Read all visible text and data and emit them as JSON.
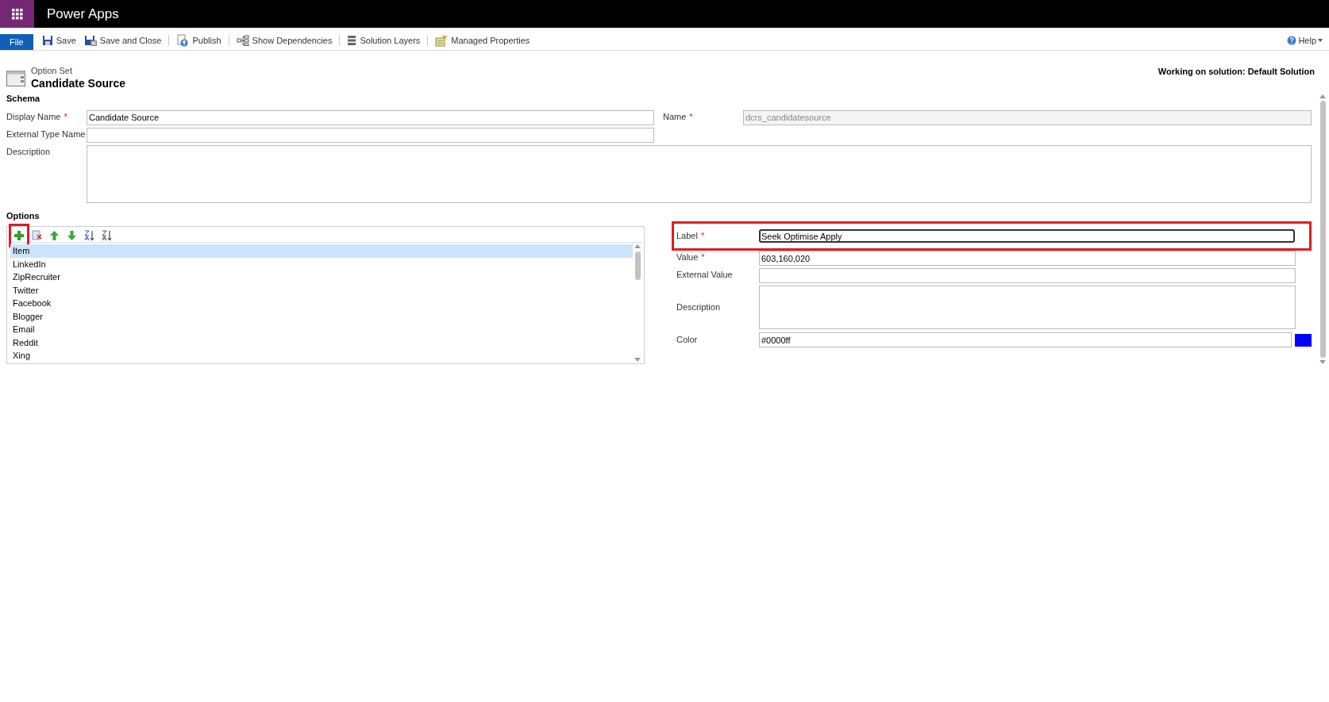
{
  "app": {
    "title": "Power Apps"
  },
  "toolbar": {
    "file": "File",
    "items": [
      {
        "kind": "save",
        "label": "Save"
      },
      {
        "kind": "save-close",
        "label": "Save and Close"
      },
      {
        "kind": "publish",
        "label": "Publish"
      },
      {
        "kind": "dependencies",
        "label": "Show Dependencies"
      },
      {
        "kind": "layers",
        "label": "Solution Layers"
      },
      {
        "kind": "managed",
        "label": "Managed Properties"
      }
    ],
    "help": "Help"
  },
  "header": {
    "type": "Option Set",
    "title": "Candidate Source",
    "solution": "Working on solution: Default Solution"
  },
  "schema": {
    "heading": "Schema",
    "display_name": {
      "label": "Display Name",
      "required_mark": "*",
      "value": "Candidate Source"
    },
    "name": {
      "label": "Name",
      "required_mark": "*",
      "value": "dcrs_candidatesource",
      "disabled": true
    },
    "external_type_name": {
      "label": "External Type Name"
    },
    "description": {
      "label": "Description"
    }
  },
  "options": {
    "heading": "Options",
    "tools": [
      {
        "kind": "add",
        "highlighted": true
      },
      {
        "kind": "delete",
        "highlighted": false
      },
      {
        "kind": "up",
        "highlighted": false
      },
      {
        "kind": "down",
        "highlighted": false
      },
      {
        "kind": "sort-az",
        "highlighted": false
      },
      {
        "kind": "sort-za",
        "highlighted": false
      }
    ],
    "items": [
      {
        "label": "Item",
        "selected": true
      },
      {
        "label": "LinkedIn",
        "selected": false
      },
      {
        "label": "ZipRecruiter",
        "selected": false
      },
      {
        "label": "Twitter",
        "selected": false
      },
      {
        "label": "Facebook",
        "selected": false
      },
      {
        "label": "Blogger",
        "selected": false
      },
      {
        "label": "Email",
        "selected": false
      },
      {
        "label": "Reddit",
        "selected": false
      },
      {
        "label": "Xing",
        "selected": false
      }
    ]
  },
  "option_form": {
    "label": {
      "label": "Label",
      "required_mark": "*",
      "value": "Seek Optimise Apply",
      "highlighted": true
    },
    "value": {
      "label": "Value",
      "required_mark": "*",
      "value": "603,160,020"
    },
    "external_value": {
      "label": "External Value"
    },
    "description": {
      "label": "Description"
    },
    "color": {
      "label": "Color",
      "value": "#0000ff",
      "color": "#0000ff"
    }
  }
}
